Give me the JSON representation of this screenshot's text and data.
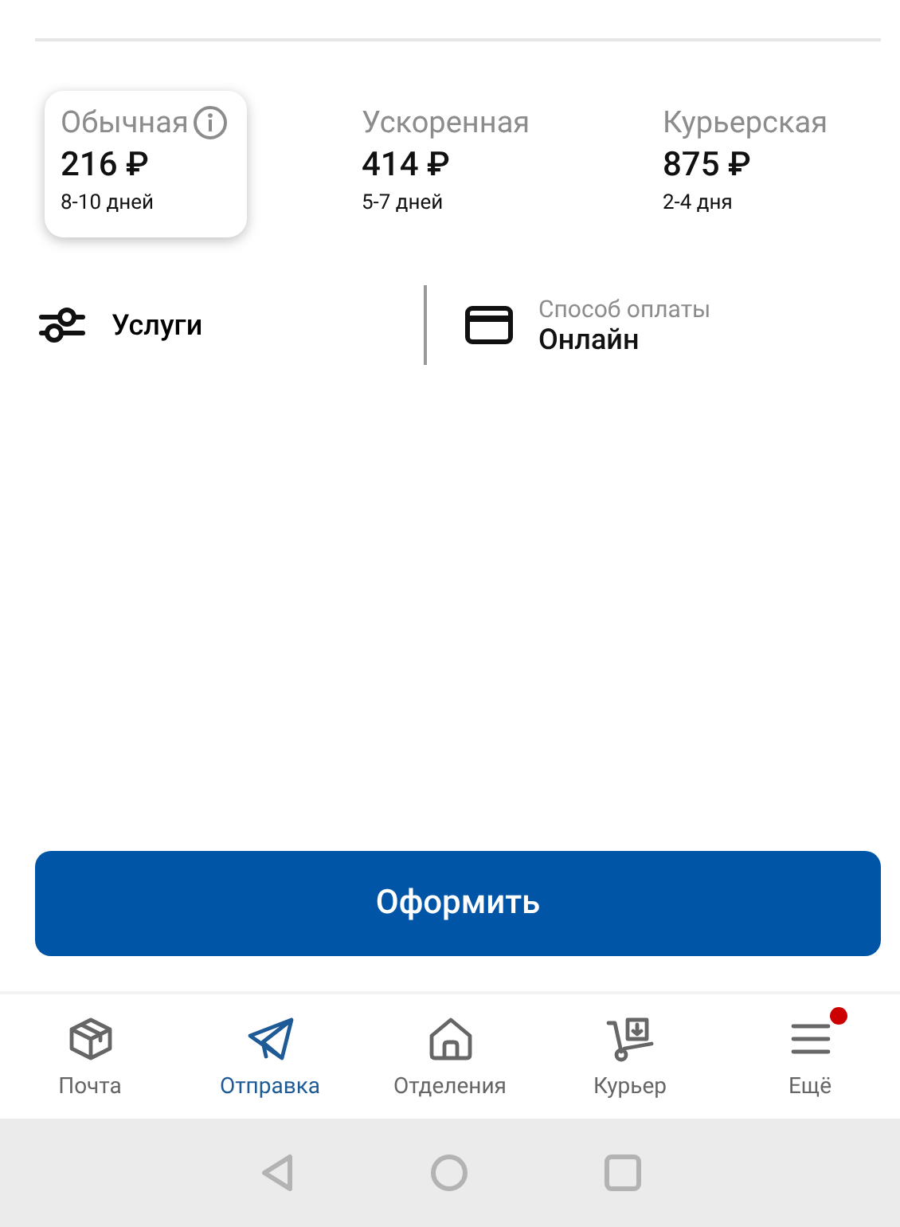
{
  "tariffs": [
    {
      "name": "Обычная",
      "price": "216 ₽",
      "term": "8-10 дней",
      "selected": true,
      "info": true
    },
    {
      "name": "Ускоренная",
      "price": "414 ₽",
      "term": "5-7 дней",
      "selected": false,
      "info": false
    },
    {
      "name": "Курьерская",
      "price": "875 ₽",
      "term": "2-4 дня",
      "selected": false,
      "info": false
    }
  ],
  "services": {
    "label": "Услуги"
  },
  "payment": {
    "label": "Способ оплаты",
    "value": "Онлайн"
  },
  "submit_button": "Оформить",
  "bottom_nav": [
    {
      "kind": "box",
      "label": "Почта",
      "selected": false,
      "badge": false
    },
    {
      "kind": "send",
      "label": "Отправка",
      "selected": true,
      "badge": false
    },
    {
      "kind": "home",
      "label": "Отделения",
      "selected": false,
      "badge": false
    },
    {
      "kind": "courier",
      "label": "Курьер",
      "selected": false,
      "badge": false
    },
    {
      "kind": "menu",
      "label": "Ещё",
      "selected": false,
      "badge": true
    }
  ]
}
